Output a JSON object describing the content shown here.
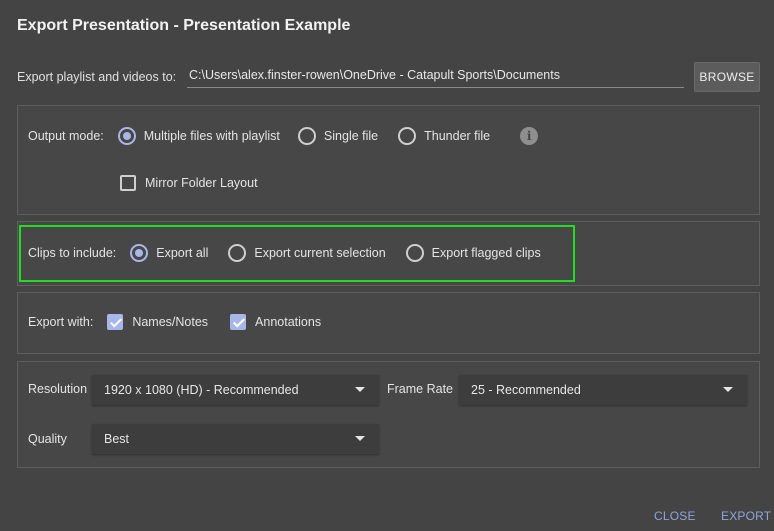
{
  "dialog": {
    "title": "Export Presentation - Presentation Example"
  },
  "export_path": {
    "label": "Export playlist and videos to:",
    "value": "C:\\Users\\alex.finster-rowen\\OneDrive - Catapult Sports\\Documents",
    "browse_label": "BROWSE"
  },
  "output_mode": {
    "label": "Output mode:",
    "options": [
      "Multiple files with playlist",
      "Single file",
      "Thunder file"
    ],
    "selected": "Multiple files with playlist",
    "info_icon": "info-icon",
    "mirror_label": "Mirror Folder Layout",
    "mirror_checked": false
  },
  "clips": {
    "label": "Clips to include:",
    "options": [
      "Export all",
      "Export current selection",
      "Export flagged clips"
    ],
    "selected": "Export all",
    "highlight_color": "#22dd22"
  },
  "export_with": {
    "label": "Export with:",
    "names_notes_label": "Names/Notes",
    "names_notes_checked": true,
    "annotations_label": "Annotations",
    "annotations_checked": true
  },
  "video": {
    "resolution_label": "Resolution",
    "resolution_value": "1920 x 1080 (HD) - Recommended",
    "frame_rate_label": "Frame Rate",
    "frame_rate_value": "25 - Recommended",
    "quality_label": "Quality",
    "quality_value": "Best"
  },
  "footer": {
    "close_label": "CLOSE",
    "export_label": "EXPORT"
  },
  "colors": {
    "accent": "#a9b6e8",
    "background": "#444444",
    "link": "#8fa4d8"
  }
}
